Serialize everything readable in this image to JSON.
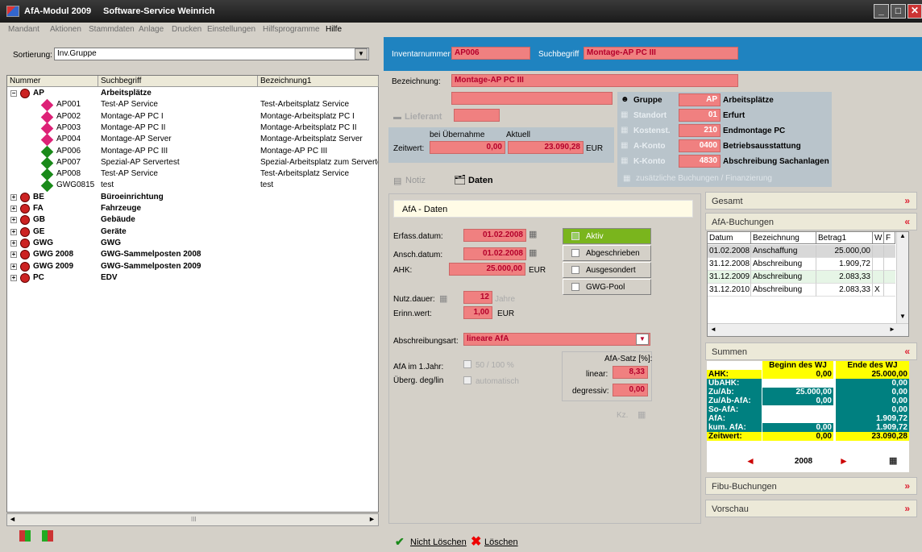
{
  "window": {
    "app": "AfA-Modul 2009",
    "company": "Software-Service Weinrich"
  },
  "menu": [
    "Mandant",
    "Aktionen",
    "Stammdaten",
    "Anlage",
    "Drucken",
    "Einstellungen",
    "Hilfsprogramme",
    "Hilfe"
  ],
  "sort": {
    "label": "Sortierung:",
    "value": "Inv.Gruppe"
  },
  "tree": {
    "cols": [
      "Nummer",
      "Suchbegriff",
      "Bezeichnung1"
    ],
    "rows": [
      {
        "lvl": 0,
        "no": "AP",
        "such": "Arbeitsplätze",
        "bez": "",
        "icon": "group",
        "exp": "−"
      },
      {
        "lvl": 1,
        "no": "AP001",
        "such": "Test-AP Service",
        "bez": "Test-Arbeitsplatz Service",
        "icon": "pink"
      },
      {
        "lvl": 1,
        "no": "AP002",
        "such": "Montage-AP PC I",
        "bez": "Montage-Arbeitsplatz PC I",
        "icon": "pink"
      },
      {
        "lvl": 1,
        "no": "AP003",
        "such": "Montage-AP PC II",
        "bez": "Montage-Arbeitsplatz PC II",
        "icon": "pink"
      },
      {
        "lvl": 1,
        "no": "AP004",
        "such": "Montage-AP Server",
        "bez": "Montage-Arbeitsplatz Server",
        "icon": "pink"
      },
      {
        "lvl": 1,
        "no": "AP006",
        "such": "Montage-AP PC III",
        "bez": "Montage-AP PC III",
        "icon": "green"
      },
      {
        "lvl": 1,
        "no": "AP007",
        "such": "Spezial-AP Servertest",
        "bez": "Spezial-Arbeitsplatz zum Servertest",
        "icon": "green"
      },
      {
        "lvl": 1,
        "no": "AP008",
        "such": "Test-AP Service",
        "bez": "Test-Arbeitsplatz Service",
        "icon": "green"
      },
      {
        "lvl": 1,
        "no": "GWG0815",
        "such": "test",
        "bez": "test",
        "icon": "green"
      },
      {
        "lvl": 0,
        "no": "BE",
        "such": "Büroeinrichtung",
        "bez": "",
        "icon": "group",
        "exp": "+"
      },
      {
        "lvl": 0,
        "no": "FA",
        "such": "Fahrzeuge",
        "bez": "",
        "icon": "group",
        "exp": "+"
      },
      {
        "lvl": 0,
        "no": "GB",
        "such": "Gebäude",
        "bez": "",
        "icon": "group",
        "exp": "+"
      },
      {
        "lvl": 0,
        "no": "GE",
        "such": "Geräte",
        "bez": "",
        "icon": "group",
        "exp": "+"
      },
      {
        "lvl": 0,
        "no": "GWG",
        "such": "GWG",
        "bez": "",
        "icon": "group",
        "exp": "+"
      },
      {
        "lvl": 0,
        "no": "GWG 2008",
        "such": "GWG-Sammelposten 2008",
        "bez": "",
        "icon": "group",
        "exp": "+"
      },
      {
        "lvl": 0,
        "no": "GWG 2009",
        "such": "GWG-Sammelposten 2009",
        "bez": "",
        "icon": "group",
        "exp": "+"
      },
      {
        "lvl": 0,
        "no": "PC",
        "such": "EDV",
        "bez": "",
        "icon": "group",
        "exp": "+"
      }
    ]
  },
  "scroll_mark": "III",
  "header": {
    "inv_label": "Inventarnummer",
    "inv_value": "AP006",
    "such_label": "Suchbegriff",
    "such_value": "Montage-AP PC III"
  },
  "bez": {
    "label": "Bezeichnung:",
    "value": "Montage-AP PC III"
  },
  "lieferant": "Lieferant",
  "zeitwert": {
    "bei": "bei Übernahme",
    "aktuell": "Aktuell",
    "label": "Zeitwert:",
    "v1": "0,00",
    "v2": "23.090,28",
    "cur": "EUR"
  },
  "notiz": "Notiz",
  "daten": "Daten",
  "info": [
    {
      "label": "Gruppe",
      "code": "AP",
      "text": "Arbeitsplätze"
    },
    {
      "label": "Standort",
      "code": "01",
      "text": "Erfurt"
    },
    {
      "label": "Kostenst.",
      "code": "210",
      "text": "Endmontage PC"
    },
    {
      "label": "A-Konto",
      "code": "0400",
      "text": "Betriebsausstattung"
    },
    {
      "label": "K-Konto",
      "code": "4830",
      "text": "Abschreibung Sachanlagen"
    }
  ],
  "zusatz": "zusätzliche Buchungen / Finanzierung",
  "afa": {
    "title": "AfA - Daten",
    "erfass_label": "Erfass.datum:",
    "erfass": "01.02.2008",
    "ansch_label": "Ansch.datum:",
    "ansch": "01.02.2008",
    "ahk_label": "AHK:",
    "ahk": "25.000,00",
    "cur": "EUR",
    "nutz_label": "Nutz.dauer:",
    "nutz": "12",
    "jahre": "Jahre",
    "erinn_label": "Erinn.wert:",
    "erinn": "1,00",
    "art_label": "Abschreibungsart:",
    "art": "lineare AfA",
    "jahr1_label": "AfA im 1.Jahr:",
    "jahr1_opt": "50 / 100 %",
    "ueberg_label": "Überg. deg/lin",
    "ueberg_opt": "automatisch",
    "satz_label": "AfA-Satz [%]:",
    "linear_label": "linear:",
    "linear": "8,33",
    "degr_label": "degressiv:",
    "degr": "0,00",
    "kz": "Kz."
  },
  "status": {
    "aktiv": "Aktiv",
    "abgeschrieben": "Abgeschrieben",
    "ausgesondert": "Ausgesondert",
    "gwg": "GWG-Pool"
  },
  "sections": {
    "gesamt": "Gesamt",
    "buchungen": "AfA-Buchungen",
    "summen": "Summen",
    "fibu": "Fibu-Buchungen",
    "vorschau": "Vorschau"
  },
  "buch": {
    "cols": [
      "Datum",
      "Bezeichnung",
      "Betrag1",
      "W",
      "F"
    ],
    "rows": [
      [
        "01.02.2008",
        "Anschaffung",
        "25.000,00",
        ""
      ],
      [
        "31.12.2008",
        "Abschreibung",
        "1.909,72",
        ""
      ],
      [
        "31.12.2009",
        "Abschreibung",
        "2.083,33",
        ""
      ],
      [
        "31.12.2010",
        "Abschreibung",
        "2.083,33",
        "X"
      ]
    ]
  },
  "summen": {
    "beginn": "Beginn des WJ",
    "ende": "Ende des WJ",
    "rows": [
      [
        "AHK:",
        "0,00",
        "25.000,00"
      ],
      [
        "UbAHK:",
        "",
        "0,00"
      ],
      [
        "Zu/Ab:",
        "25.000,00",
        "0,00"
      ],
      [
        "Zu/Ab-AfA:",
        "0,00",
        "0,00"
      ],
      [
        "So-AfA:",
        "",
        "0,00"
      ],
      [
        "AfA:",
        "",
        "1.909,72"
      ],
      [
        "kum. AfA:",
        "0,00",
        "1.909,72"
      ],
      [
        "Zeitwert:",
        "0,00",
        "23.090,28"
      ]
    ],
    "year": "2008"
  },
  "bottom": {
    "nicht": "Nicht Löschen",
    "loeschen": "Löschen"
  },
  "colors": {
    "pink": "#f08080",
    "blue": "#1f83c0",
    "yellow": "#ffff00",
    "teal": "#008080",
    "green": "#7ab51d"
  }
}
